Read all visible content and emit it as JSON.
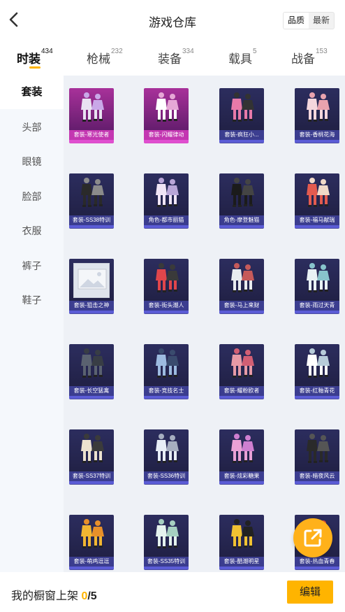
{
  "header": {
    "title": "游戏仓库",
    "sort": [
      "品质",
      "最新"
    ],
    "sort_active": 0
  },
  "tabs": [
    {
      "label": "时装",
      "count": "434"
    },
    {
      "label": "枪械",
      "count": "232"
    },
    {
      "label": "装备",
      "count": "334"
    },
    {
      "label": "载具",
      "count": "5"
    },
    {
      "label": "战备",
      "count": "153"
    }
  ],
  "sidebar": {
    "items": [
      "套装",
      "头部",
      "眼镜",
      "脸部",
      "衣服",
      "裤子",
      "鞋子"
    ]
  },
  "items": [
    {
      "name": "套装-寒光使者",
      "rarity": "legendary"
    },
    {
      "name": "套装-闪耀律动",
      "rarity": "legendary"
    },
    {
      "name": "套装-疯狂小...",
      "rarity": "epic"
    },
    {
      "name": "套装-香桃花海",
      "rarity": "epic"
    },
    {
      "name": "套装-SS38特训",
      "rarity": "epic"
    },
    {
      "name": "角色-都市丽猫",
      "rarity": "epic"
    },
    {
      "name": "角色-摩登魅猫",
      "rarity": "epic"
    },
    {
      "name": "套装-福马献瑞",
      "rarity": "epic"
    },
    {
      "name": "套装-狙击之神",
      "rarity": "epic"
    },
    {
      "name": "套装-街头潮人",
      "rarity": "epic"
    },
    {
      "name": "套装-马上来财",
      "rarity": "epic"
    },
    {
      "name": "套装-雨过天青",
      "rarity": "epic"
    },
    {
      "name": "套装-长空猛禽",
      "rarity": "epic"
    },
    {
      "name": "套装-竞技名士",
      "rarity": "epic"
    },
    {
      "name": "套装-耀粉欧者",
      "rarity": "epic"
    },
    {
      "name": "套装-红釉青花",
      "rarity": "epic"
    },
    {
      "name": "套装-SS37特训",
      "rarity": "epic"
    },
    {
      "name": "套装-SS36特训",
      "rarity": "epic"
    },
    {
      "name": "套装-炫彩糖果",
      "rarity": "epic"
    },
    {
      "name": "套装-暗夜风云",
      "rarity": "epic"
    },
    {
      "name": "套装-萌鸡逗逗",
      "rarity": "epic"
    },
    {
      "name": "套装-SS35特训",
      "rarity": "epic"
    },
    {
      "name": "套装-酷潮明星",
      "rarity": "epic"
    },
    {
      "name": "套装-热血青春",
      "rarity": "epic"
    }
  ],
  "footer": {
    "label": "我的橱窗上架 ",
    "count": "0",
    "total": "/5",
    "edit_label": "编辑"
  },
  "icons": {
    "back": "back-arrow-icon",
    "fab": "share-external-icon"
  },
  "colors": {
    "accent": "#ffb400",
    "legendary_card": "#a8319a",
    "epic_card": "#2c2d5e"
  }
}
